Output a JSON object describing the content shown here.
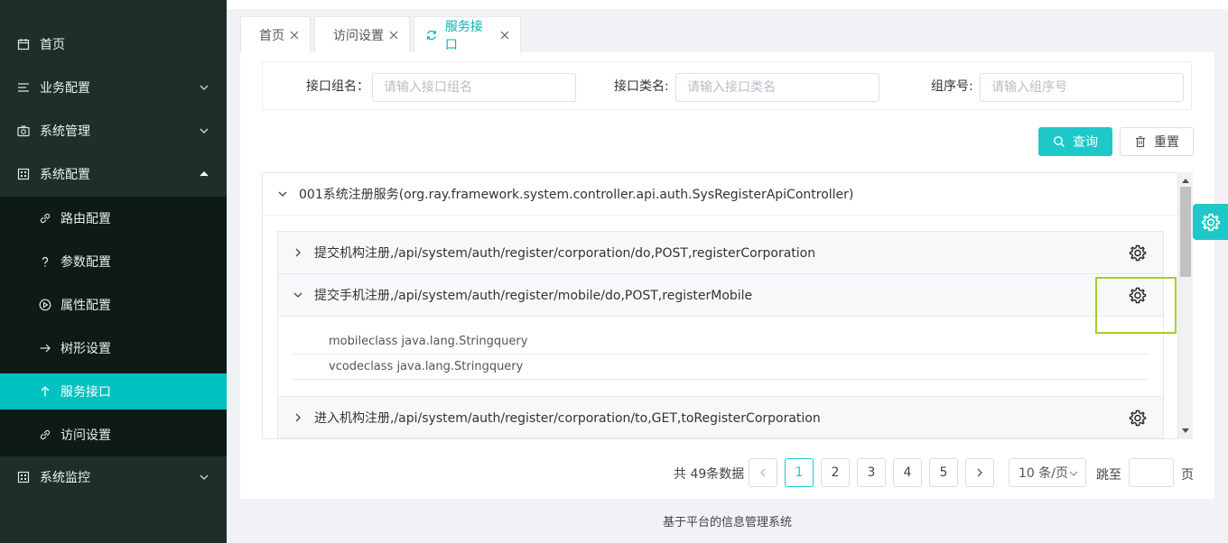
{
  "sidebar": {
    "items": [
      {
        "label": "首页",
        "icon": "calendar-icon"
      },
      {
        "label": "业务配置",
        "icon": "list-icon"
      },
      {
        "label": "系统管理",
        "icon": "camera-icon"
      },
      {
        "label": "系统配置",
        "icon": "grid-icon"
      },
      {
        "label": "系统监控",
        "icon": "grid-icon"
      }
    ],
    "subitems": [
      {
        "label": "路由配置",
        "icon": "link-icon"
      },
      {
        "label": "参数配置",
        "icon": "question-icon"
      },
      {
        "label": "属性配置",
        "icon": "play-circle-icon"
      },
      {
        "label": "树形设置",
        "icon": "arrow-right-icon"
      },
      {
        "label": "服务接口",
        "icon": "arrow-up-icon"
      },
      {
        "label": "访问设置",
        "icon": "link-icon"
      }
    ]
  },
  "tabs": [
    {
      "label": "首页"
    },
    {
      "label": "访问设置"
    },
    {
      "label": "服务接口"
    }
  ],
  "search": {
    "group_name_label": "接口组名：",
    "group_name_placeholder": "请输入接口组名",
    "class_name_label": "接口类名:",
    "class_name_placeholder": "请输入接口类名",
    "order_label": "组序号:",
    "order_placeholder": "请输入组序号",
    "query_label": "查询",
    "reset_label": "重置"
  },
  "tree": {
    "group_title": "001系统注册服务(org.ray.framework.system.controller.api.auth.SysRegisterApiController)",
    "rows": [
      {
        "label": "提交机构注册,/api/system/auth/register/corporation/do,POST,registerCorporation"
      },
      {
        "label": "提交手机注册,/api/system/auth/register/mobile/do,POST,registerMobile"
      },
      {
        "label": "进入机构注册,/api/system/auth/register/corporation/to,GET,toRegisterCorporation"
      }
    ],
    "params": [
      {
        "text": "mobileclass java.lang.Stringquery"
      },
      {
        "text": "vcodeclass java.lang.Stringquery"
      }
    ]
  },
  "pagination": {
    "total": "共 49条数据",
    "pages": [
      "1",
      "2",
      "3",
      "4",
      "5"
    ],
    "current": "1",
    "page_size": "10 条/页",
    "jump_label": "跳至",
    "page_suffix": "页"
  },
  "footer": {
    "text": "基于平台的信息管理系统"
  },
  "colors": {
    "accent": "#1fc8c8",
    "sidebar": "#1e2f2b",
    "highlight": "#a6cf2a"
  }
}
